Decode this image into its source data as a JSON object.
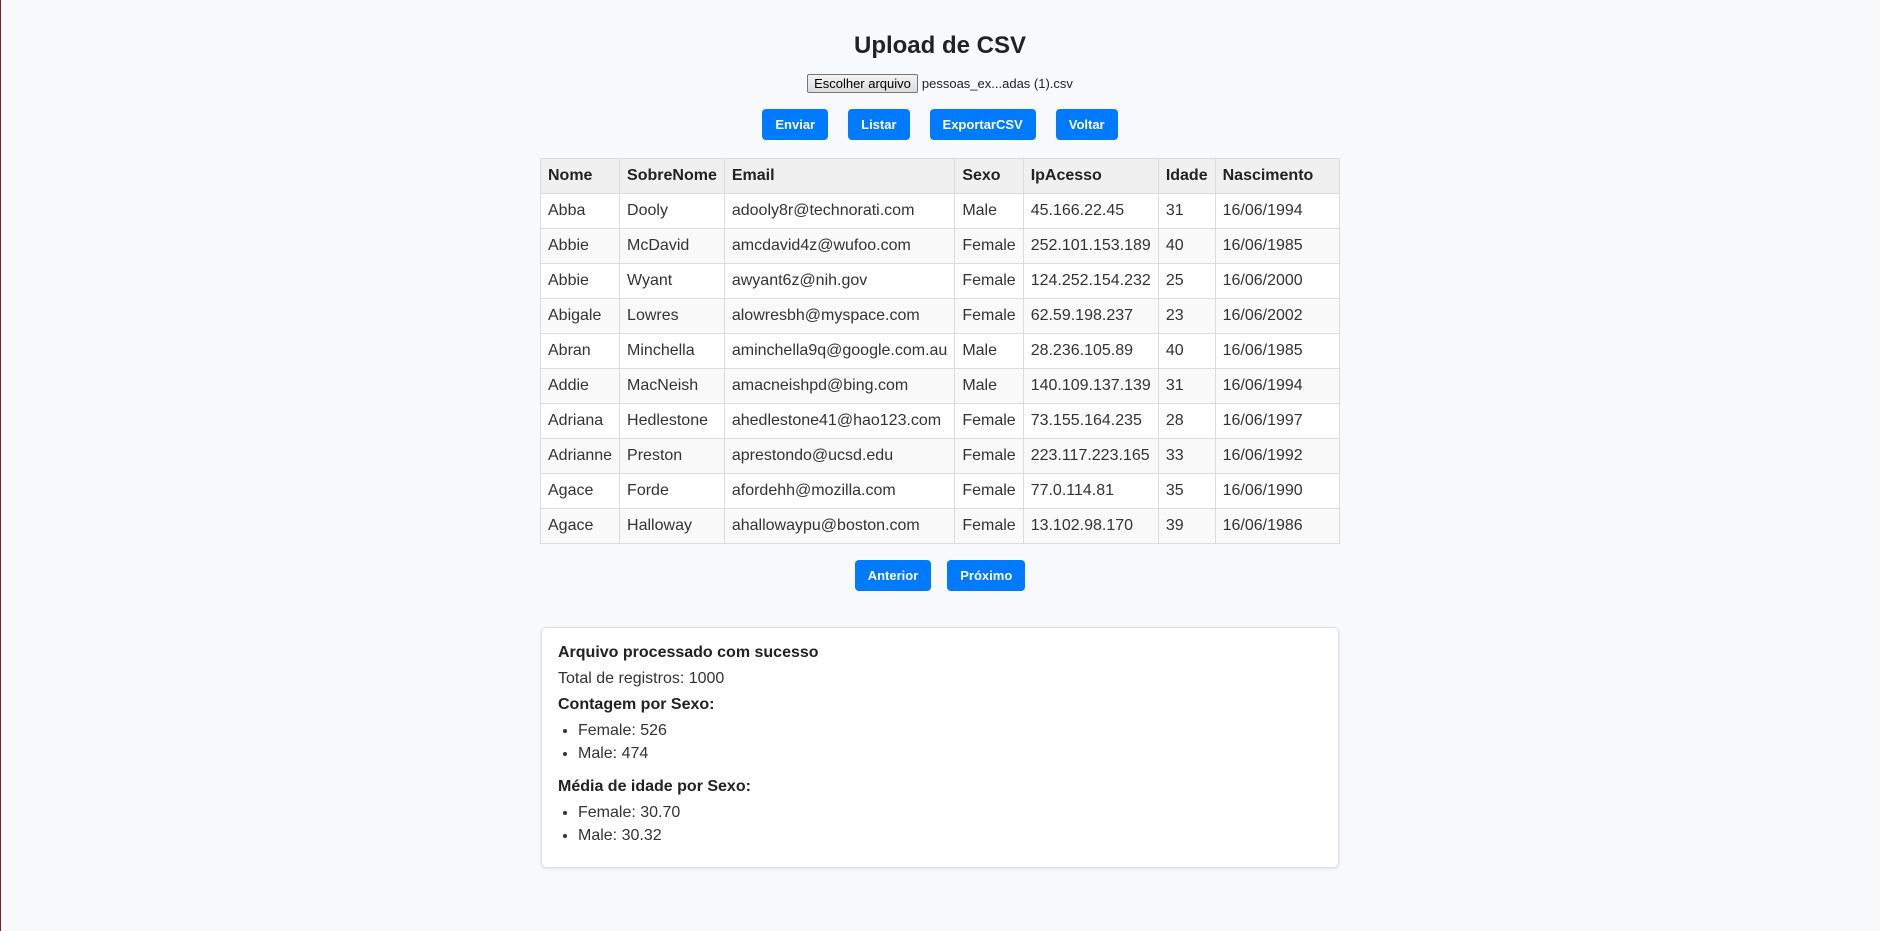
{
  "page": {
    "title": "Upload de CSV",
    "file_button": "Escolher arquivo",
    "file_name": "pessoas_ex...adas (1).csv"
  },
  "actions": {
    "enviar": "Enviar",
    "listar": "Listar",
    "exportar": "ExportarCSV",
    "voltar": "Voltar"
  },
  "table": {
    "headers": [
      "Nome",
      "SobreNome",
      "Email",
      "Sexo",
      "IpAcesso",
      "Idade",
      "Nascimento"
    ],
    "rows": [
      [
        "Abba",
        "Dooly",
        "adooly8r@technorati.com",
        "Male",
        "45.166.22.45",
        "31",
        "16/06/1994"
      ],
      [
        "Abbie",
        "McDavid",
        "amcdavid4z@wufoo.com",
        "Female",
        "252.101.153.189",
        "40",
        "16/06/1985"
      ],
      [
        "Abbie",
        "Wyant",
        "awyant6z@nih.gov",
        "Female",
        "124.252.154.232",
        "25",
        "16/06/2000"
      ],
      [
        "Abigale",
        "Lowres",
        "alowresbh@myspace.com",
        "Female",
        "62.59.198.237",
        "23",
        "16/06/2002"
      ],
      [
        "Abran",
        "Minchella",
        "aminchella9q@google.com.au",
        "Male",
        "28.236.105.89",
        "40",
        "16/06/1985"
      ],
      [
        "Addie",
        "MacNeish",
        "amacneishpd@bing.com",
        "Male",
        "140.109.137.139",
        "31",
        "16/06/1994"
      ],
      [
        "Adriana",
        "Hedlestone",
        "ahedlestone41@hao123.com",
        "Female",
        "73.155.164.235",
        "28",
        "16/06/1997"
      ],
      [
        "Adrianne",
        "Preston",
        "aprestondo@ucsd.edu",
        "Female",
        "223.117.223.165",
        "33",
        "16/06/1992"
      ],
      [
        "Agace",
        "Forde",
        "afordehh@mozilla.com",
        "Female",
        "77.0.114.81",
        "35",
        "16/06/1990"
      ],
      [
        "Agace",
        "Halloway",
        "ahallowaypu@boston.com",
        "Female",
        "13.102.98.170",
        "39",
        "16/06/1986"
      ]
    ]
  },
  "pagination": {
    "prev": "Anterior",
    "next": "Próximo"
  },
  "summary": {
    "heading": "Arquivo processado com sucesso",
    "total": "Total de registros: 1000",
    "count_title": "Contagem por Sexo:",
    "count_items": [
      "Female: 526",
      "Male: 474"
    ],
    "avg_title": "Média de idade por Sexo:",
    "avg_items": [
      "Female: 30.70",
      "Male: 30.32"
    ]
  },
  "colors": {
    "accent": "#007bff",
    "background": "#f8f9fa"
  }
}
